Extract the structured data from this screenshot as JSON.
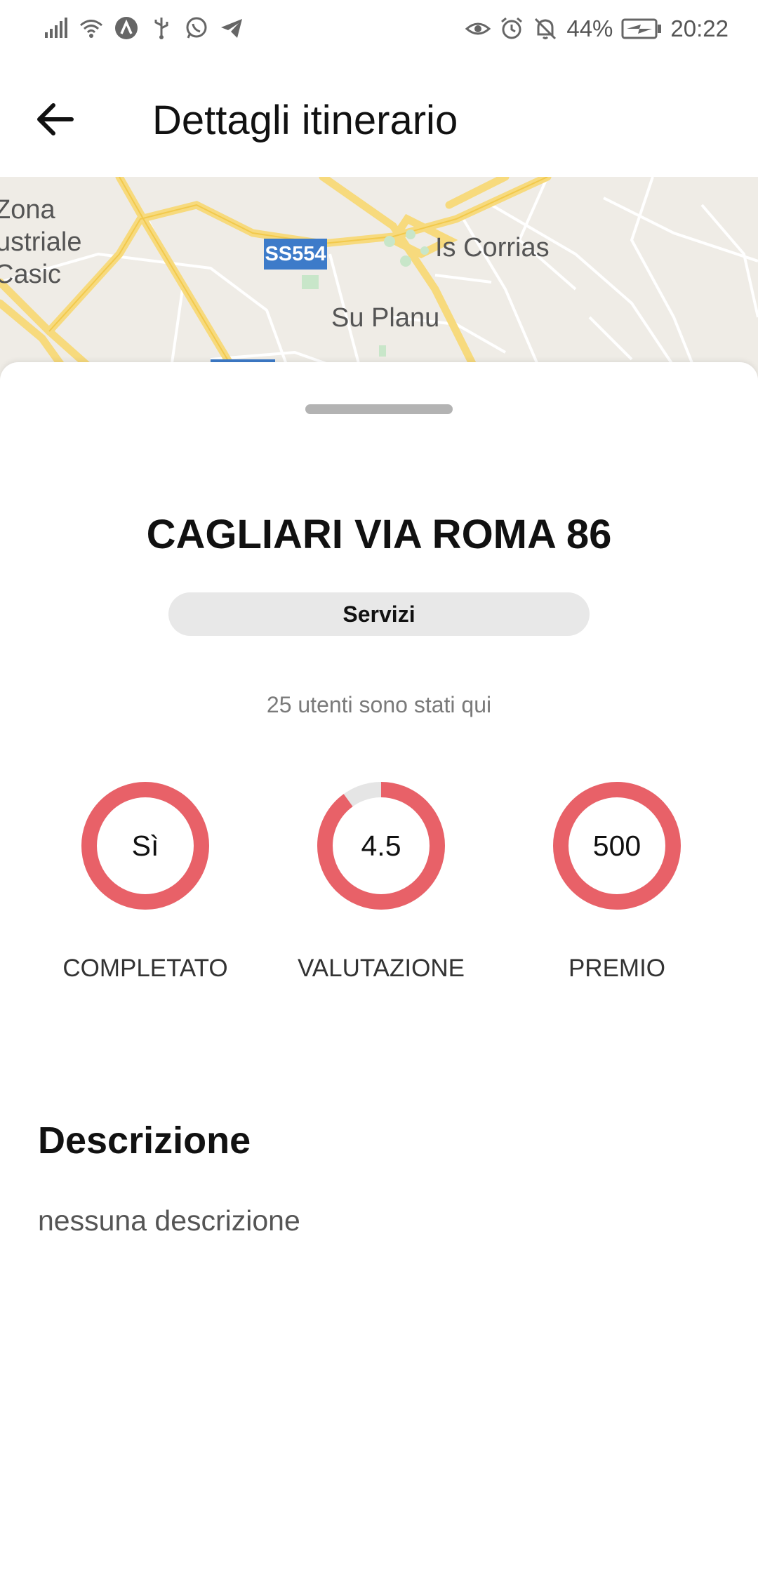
{
  "status_bar": {
    "battery": "44%",
    "time": "20:22"
  },
  "app_bar": {
    "title": "Dettagli itinerario"
  },
  "map": {
    "labels": {
      "zona": "Zona",
      "industriale": "ustriale",
      "casic": "Casic",
      "is_corrias": "Is Corrias",
      "su_planu": "Su Planu"
    },
    "road_shield": "SS554"
  },
  "itinerary": {
    "name": "CAGLIARI VIA ROMA 86",
    "category": "Servizi",
    "visitors": "25 utenti sono stati qui"
  },
  "stats": [
    {
      "value": "Sì",
      "label": "COMPLETATO",
      "fill": 1.0
    },
    {
      "value": "4.5",
      "label": "VALUTAZIONE",
      "fill": 0.9
    },
    {
      "value": "500",
      "label": "PREMIO",
      "fill": 1.0
    }
  ],
  "description": {
    "title": "Descrizione",
    "text": "nessuna descrizione"
  },
  "colors": {
    "ring": "#e86168",
    "ring_track": "#e5e5e5",
    "shield": "#3d7bc9"
  }
}
